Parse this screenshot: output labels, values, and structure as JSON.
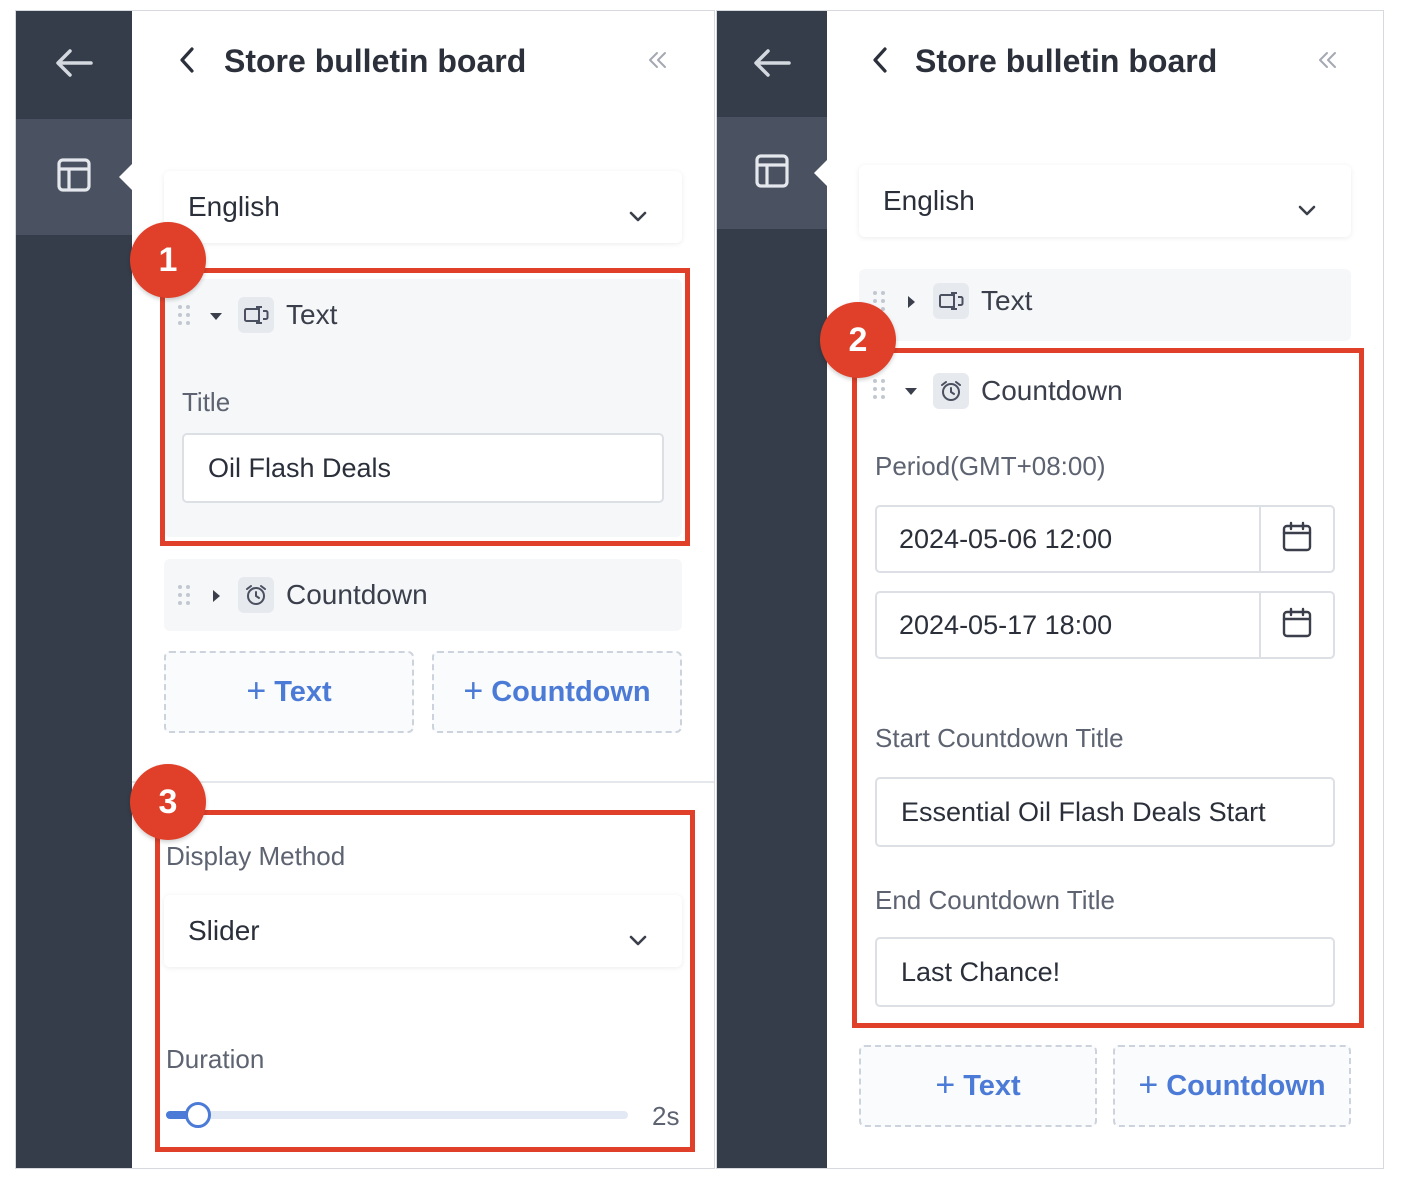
{
  "app": {
    "title": "Store bulletin board"
  },
  "colors": {
    "rail": "#363d4a",
    "rail_active": "#4a5160",
    "accent": "#4b7bd6",
    "callout": "#e0402a"
  },
  "icons": {
    "back": "arrow-left-icon",
    "layout": "layout-icon",
    "header_back": "chevron-left-icon",
    "collapse": "double-chevron-left-icon",
    "text_block": "text-cursor-icon",
    "countdown_block": "alarm-clock-icon",
    "calendar": "calendar-icon"
  },
  "panel_a": {
    "language": "English",
    "text_block": {
      "label": "Text",
      "expanded": true,
      "title_label": "Title",
      "title_value": "Oil Flash Deals"
    },
    "countdown_block": {
      "label": "Countdown",
      "expanded": false
    },
    "add_text": "Text",
    "add_countdown": "Countdown",
    "display_method": {
      "label": "Display Method",
      "value": "Slider"
    },
    "duration": {
      "label": "Duration",
      "value_text": "2s",
      "level": 0.07
    },
    "badges": {
      "one": "1",
      "three": "3"
    }
  },
  "panel_b": {
    "language": "English",
    "text_block": {
      "label": "Text",
      "expanded": false
    },
    "countdown_block": {
      "label": "Countdown",
      "expanded": true,
      "period_label": "Period(GMT+08:00)",
      "start_date": "2024-05-06 12:00",
      "end_date": "2024-05-17 18:00",
      "start_title_label": "Start Countdown Title",
      "start_title_value": "Essential Oil Flash Deals Start",
      "end_title_label": "End Countdown Title",
      "end_title_value": "Last Chance!"
    },
    "add_text": "Text",
    "add_countdown": "Countdown",
    "badges": {
      "two": "2"
    }
  }
}
